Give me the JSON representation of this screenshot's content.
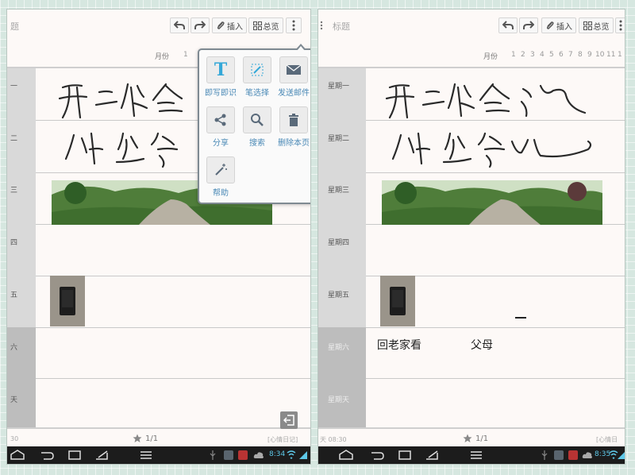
{
  "left": {
    "title": "题",
    "toolbar": {
      "insert_label": "插入",
      "overview_label": "总览"
    },
    "month": {
      "label": "月份",
      "first_num": "1"
    },
    "day_labels": [
      "一",
      "二",
      "三",
      "四",
      "五",
      "六",
      "天"
    ],
    "page": {
      "count": "1/1",
      "time_partial": "30",
      "diary_tag": "[心情日记]"
    },
    "clock": "8:34",
    "menu": {
      "items": [
        {
          "label": "即写即识",
          "icon": "text-recognition-icon"
        },
        {
          "label": "笔选择",
          "icon": "pen-select-icon"
        },
        {
          "label": "发送邮件",
          "icon": "mail-icon"
        },
        {
          "label": "分享",
          "icon": "share-icon"
        },
        {
          "label": "搜索",
          "icon": "search-icon"
        },
        {
          "label": "删除本页",
          "icon": "trash-icon"
        },
        {
          "label": "帮助",
          "icon": "magic-wand-icon"
        }
      ]
    }
  },
  "right": {
    "title": "标题",
    "toolbar": {
      "insert_label": "插入",
      "overview_label": "总览"
    },
    "month": {
      "label": "月份",
      "nums": [
        "1",
        "2",
        "3",
        "4",
        "5",
        "6",
        "7",
        "8",
        "9",
        "10",
        "11",
        "1"
      ]
    },
    "day_labels": [
      "星期一",
      "星期二",
      "星期三",
      "星期四",
      "星期五",
      "星期六",
      "星期天"
    ],
    "typed_text": {
      "line1": "回老家看",
      "line1b": "父母"
    },
    "page": {
      "count": "1/1",
      "time_partial": "天 08:30",
      "diary_tag": "[心情日"
    },
    "clock": "8:35"
  },
  "colors": {
    "accent": "#4a89b6",
    "navbar": "#1c1c1c",
    "clock": "#5ec8e8",
    "label_col": "#d9d9d9",
    "weekend_col": "#bdbdbd"
  }
}
